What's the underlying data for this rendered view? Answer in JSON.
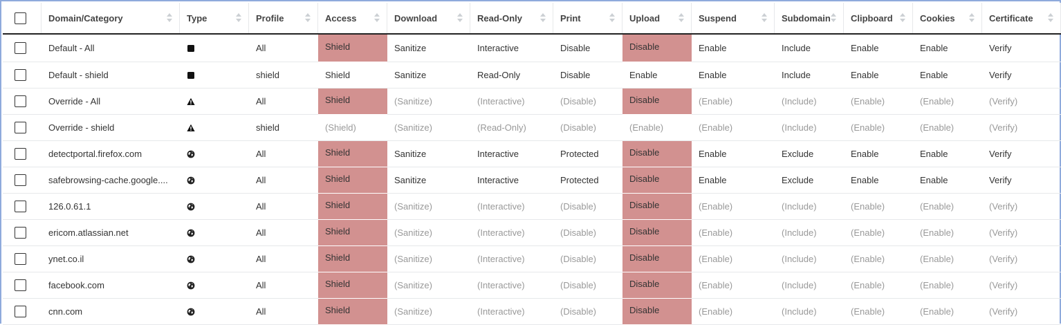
{
  "columns": [
    {
      "key": "domain",
      "label": "Domain/Category"
    },
    {
      "key": "type",
      "label": "Type"
    },
    {
      "key": "profile",
      "label": "Profile"
    },
    {
      "key": "access",
      "label": "Access"
    },
    {
      "key": "download",
      "label": "Download"
    },
    {
      "key": "readonly",
      "label": "Read-Only"
    },
    {
      "key": "print",
      "label": "Print"
    },
    {
      "key": "upload",
      "label": "Upload"
    },
    {
      "key": "suspend",
      "label": "Suspend"
    },
    {
      "key": "subdomain",
      "label": "Subdomain"
    },
    {
      "key": "clipboard",
      "label": "Clipboard"
    },
    {
      "key": "cookies",
      "label": "Cookies"
    },
    {
      "key": "certificate",
      "label": "Certificate"
    }
  ],
  "colors": {
    "highlight": "#d29190",
    "inherited_text": "#999999",
    "frame_border": "#8faadc"
  },
  "rows": [
    {
      "domain": "Default - All",
      "type": "square-icon",
      "profile": "All",
      "access": "Shield",
      "download": "Sanitize",
      "readonly": "Interactive",
      "print": "Disable",
      "upload": "Disable",
      "suspend": "Enable",
      "subdomain": "Include",
      "clipboard": "Enable",
      "cookies": "Enable",
      "certificate": "Verify",
      "highlight": [
        "access",
        "upload"
      ],
      "dim": []
    },
    {
      "domain": "Default - shield",
      "type": "square-icon",
      "profile": "shield",
      "access": "Shield",
      "download": "Sanitize",
      "readonly": "Read-Only",
      "print": "Disable",
      "upload": "Enable",
      "suspend": "Enable",
      "subdomain": "Include",
      "clipboard": "Enable",
      "cookies": "Enable",
      "certificate": "Verify",
      "highlight": [],
      "dim": []
    },
    {
      "domain": "Override - All",
      "type": "warning-icon",
      "profile": "All",
      "access": "Shield",
      "download": "(Sanitize)",
      "readonly": "(Interactive)",
      "print": "(Disable)",
      "upload": "Disable",
      "suspend": "(Enable)",
      "subdomain": "(Include)",
      "clipboard": "(Enable)",
      "cookies": "(Enable)",
      "certificate": "(Verify)",
      "highlight": [
        "access",
        "upload"
      ],
      "dim": [
        "download",
        "readonly",
        "print",
        "suspend",
        "subdomain",
        "clipboard",
        "cookies",
        "certificate"
      ]
    },
    {
      "domain": "Override - shield",
      "type": "warning-icon",
      "profile": "shield",
      "access": "(Shield)",
      "download": "(Sanitize)",
      "readonly": "(Read-Only)",
      "print": "(Disable)",
      "upload": "(Enable)",
      "suspend": "(Enable)",
      "subdomain": "(Include)",
      "clipboard": "(Enable)",
      "cookies": "(Enable)",
      "certificate": "(Verify)",
      "highlight": [],
      "dim": [
        "access",
        "download",
        "readonly",
        "print",
        "upload",
        "suspend",
        "subdomain",
        "clipboard",
        "cookies",
        "certificate"
      ]
    },
    {
      "domain": "detectportal.firefox.com",
      "type": "globe-icon",
      "profile": "All",
      "access": "Shield",
      "download": "Sanitize",
      "readonly": "Interactive",
      "print": "Protected",
      "upload": "Disable",
      "suspend": "Enable",
      "subdomain": "Exclude",
      "clipboard": "Enable",
      "cookies": "Enable",
      "certificate": "Verify",
      "highlight": [
        "access",
        "upload"
      ],
      "dim": []
    },
    {
      "domain": "safebrowsing-cache.google....",
      "type": "globe-icon",
      "profile": "All",
      "access": "Shield",
      "download": "Sanitize",
      "readonly": "Interactive",
      "print": "Protected",
      "upload": "Disable",
      "suspend": "Enable",
      "subdomain": "Exclude",
      "clipboard": "Enable",
      "cookies": "Enable",
      "certificate": "Verify",
      "highlight": [
        "access",
        "upload"
      ],
      "dim": []
    },
    {
      "domain": "126.0.61.1",
      "type": "globe-icon",
      "profile": "All",
      "access": "Shield",
      "download": "(Sanitize)",
      "readonly": "(Interactive)",
      "print": "(Disable)",
      "upload": "Disable",
      "suspend": "(Enable)",
      "subdomain": "(Include)",
      "clipboard": "(Enable)",
      "cookies": "(Enable)",
      "certificate": "(Verify)",
      "highlight": [
        "access",
        "upload"
      ],
      "dim": [
        "download",
        "readonly",
        "print",
        "suspend",
        "subdomain",
        "clipboard",
        "cookies",
        "certificate"
      ]
    },
    {
      "domain": "ericom.atlassian.net",
      "type": "globe-icon",
      "profile": "All",
      "access": "Shield",
      "download": "(Sanitize)",
      "readonly": "(Interactive)",
      "print": "(Disable)",
      "upload": "Disable",
      "suspend": "(Enable)",
      "subdomain": "(Include)",
      "clipboard": "(Enable)",
      "cookies": "(Enable)",
      "certificate": "(Verify)",
      "highlight": [
        "access",
        "upload"
      ],
      "dim": [
        "download",
        "readonly",
        "print",
        "suspend",
        "subdomain",
        "clipboard",
        "cookies",
        "certificate"
      ]
    },
    {
      "domain": "ynet.co.il",
      "type": "globe-icon",
      "profile": "All",
      "access": "Shield",
      "download": "(Sanitize)",
      "readonly": "(Interactive)",
      "print": "(Disable)",
      "upload": "Disable",
      "suspend": "(Enable)",
      "subdomain": "(Include)",
      "clipboard": "(Enable)",
      "cookies": "(Enable)",
      "certificate": "(Verify)",
      "highlight": [
        "access",
        "upload"
      ],
      "dim": [
        "download",
        "readonly",
        "print",
        "suspend",
        "subdomain",
        "clipboard",
        "cookies",
        "certificate"
      ]
    },
    {
      "domain": "facebook.com",
      "type": "globe-icon",
      "profile": "All",
      "access": "Shield",
      "download": "(Sanitize)",
      "readonly": "(Interactive)",
      "print": "(Disable)",
      "upload": "Disable",
      "suspend": "(Enable)",
      "subdomain": "(Include)",
      "clipboard": "(Enable)",
      "cookies": "(Enable)",
      "certificate": "(Verify)",
      "highlight": [
        "access",
        "upload"
      ],
      "dim": [
        "download",
        "readonly",
        "print",
        "suspend",
        "subdomain",
        "clipboard",
        "cookies",
        "certificate"
      ]
    },
    {
      "domain": "cnn.com",
      "type": "globe-icon",
      "profile": "All",
      "access": "Shield",
      "download": "(Sanitize)",
      "readonly": "(Interactive)",
      "print": "(Disable)",
      "upload": "Disable",
      "suspend": "(Enable)",
      "subdomain": "(Include)",
      "clipboard": "(Enable)",
      "cookies": "(Enable)",
      "certificate": "(Verify)",
      "highlight": [
        "access",
        "upload"
      ],
      "dim": [
        "download",
        "readonly",
        "print",
        "suspend",
        "subdomain",
        "clipboard",
        "cookies",
        "certificate"
      ]
    }
  ]
}
